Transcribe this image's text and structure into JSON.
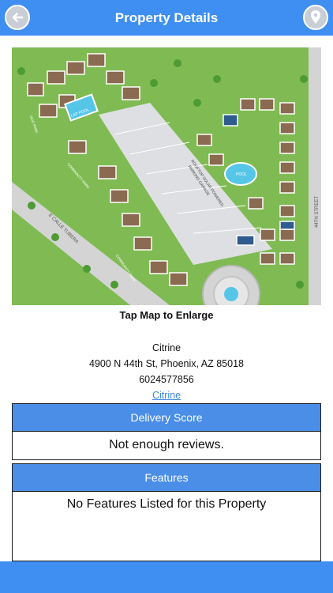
{
  "header": {
    "title": "Property Details",
    "back_icon": "arrow-left-icon",
    "location_icon": "map-pin-icon"
  },
  "map": {
    "labels": {
      "street_right": "44TH STREET",
      "street_left": "E CALLE TUBERA",
      "dog_park": "DOG PARK",
      "community_park_1": "COMMUNITY PARK",
      "community_park_2": "COMMUNITY PARK",
      "lap_pool": "LAP POOL",
      "pool": "POOL",
      "garage_1": "ROOFTOP SOLAR POWERED",
      "garage_2": "PARKING GARAGE"
    },
    "caption": "Tap Map to Enlarge"
  },
  "property": {
    "name": "Citrine",
    "address": "4900 N 44th St, Phoenix, AZ 85018",
    "phone": "6024577856",
    "link": "Citrine"
  },
  "delivery": {
    "title": "Delivery Score",
    "value": "Not enough reviews."
  },
  "features": {
    "title": "Features",
    "value": "No Features Listed for this Property"
  },
  "colors": {
    "bar": "#3f8ff2",
    "panel_header": "#4a8ee8",
    "link": "#3a86e0",
    "grass": "#7fbb52",
    "building_brown": "#8a6a50",
    "pool": "#55c6e8"
  }
}
